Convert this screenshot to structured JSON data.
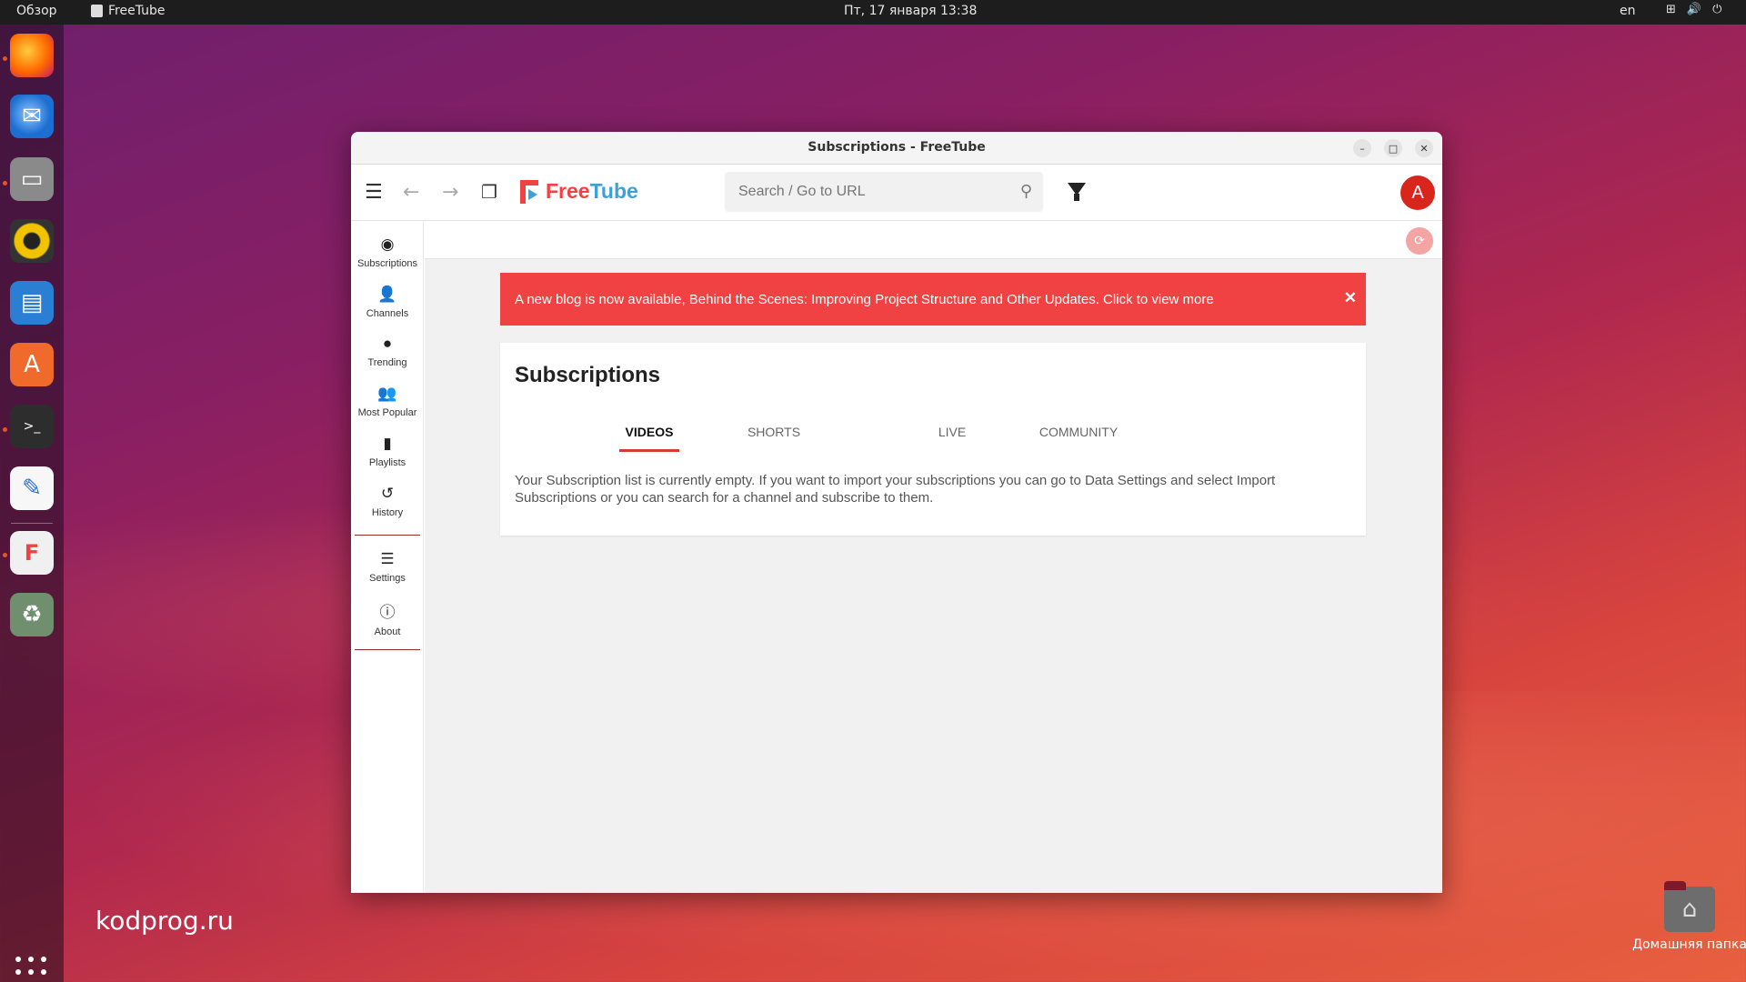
{
  "topbar": {
    "overview": "Обзор",
    "app_name": "FreeTube",
    "clock": "Пт, 17 января  13:38",
    "lang": "en"
  },
  "desktop": {
    "watermark": "kodprog.ru",
    "home_folder_label": "Домашняя папка"
  },
  "window": {
    "title": "Subscriptions - FreeTube"
  },
  "header": {
    "logo_free": "Free",
    "logo_tube": "Tube",
    "search_placeholder": "Search / Go to URL",
    "avatar_letter": "A"
  },
  "sidebar": {
    "items": [
      {
        "label": "Subscriptions",
        "icon": "rss-icon"
      },
      {
        "label": "Channels",
        "icon": "user-check-icon"
      },
      {
        "label": "Trending",
        "icon": "fire-icon"
      },
      {
        "label": "Most Popular",
        "icon": "users-icon"
      },
      {
        "label": "Playlists",
        "icon": "bookmark-icon"
      },
      {
        "label": "History",
        "icon": "history-icon"
      },
      {
        "label": "Settings",
        "icon": "sliders-icon"
      },
      {
        "label": "About",
        "icon": "info-icon"
      }
    ]
  },
  "banner": {
    "text": "A new blog is now available, Behind the Scenes: Improving Project Structure and Other Updates. Click to view more",
    "close": "✕"
  },
  "main": {
    "title": "Subscriptions",
    "tabs": [
      "VIDEOS",
      "SHORTS",
      "LIVE",
      "COMMUNITY"
    ],
    "active_tab": "VIDEOS",
    "empty_message": "Your Subscription list is currently empty. If you want to import your subscriptions you can go to Data Settings and select Import Subscriptions or you can search for a channel and subscribe to them."
  },
  "colors": {
    "accent_red": "#f04242",
    "logo_blue": "#3da0d6",
    "avatar_red": "#d9261c"
  }
}
